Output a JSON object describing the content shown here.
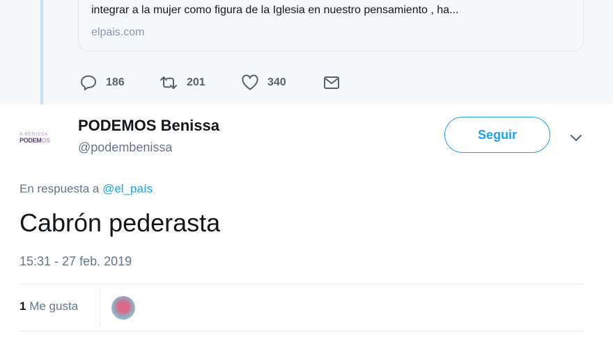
{
  "parent_tweet": {
    "link_card": {
      "description": "integrar a la mujer como figura de la Iglesia en nuestro pensamiento , ha...",
      "domain": "elpais.com"
    },
    "actions": {
      "reply_count": "186",
      "retweet_count": "201",
      "like_count": "340"
    }
  },
  "tweet": {
    "author": {
      "avatar_small_text": "A BENISSA",
      "avatar_logo_main": "PODEM",
      "avatar_logo_suffix": "OS",
      "name": "PODEMOS Benissa",
      "handle": "@podembenissa"
    },
    "follow_label": "Seguir",
    "reply_prefix": "En respuesta a",
    "reply_mention": "@el_país",
    "text": "Cabrón pederasta",
    "timestamp": "15:31 - 27 feb. 2019",
    "stats": {
      "likes_number": "1",
      "likes_label": "Me gusta"
    }
  },
  "colors": {
    "accent": "#1da1f2",
    "text_secondary": "#657786",
    "parent_background": "#f5f8fa"
  }
}
